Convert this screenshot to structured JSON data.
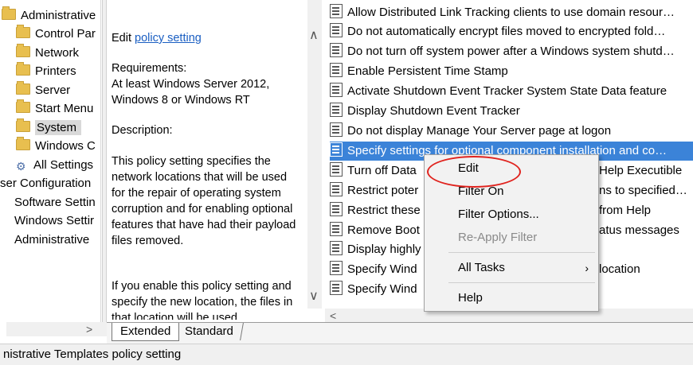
{
  "tree": {
    "items": [
      {
        "label": "Administrative",
        "icon": "folder-icon"
      },
      {
        "label": "Control Par",
        "icon": "folder-icon"
      },
      {
        "label": "Network",
        "icon": "folder-icon"
      },
      {
        "label": "Printers",
        "icon": "folder-icon"
      },
      {
        "label": "Server",
        "icon": "folder-icon"
      },
      {
        "label": "Start Menu",
        "icon": "folder-icon"
      },
      {
        "label": "System",
        "icon": "folder-icon",
        "selected": true
      },
      {
        "label": "Windows C",
        "icon": "folder-icon"
      },
      {
        "label": "All Settings",
        "icon": "settings-icon"
      },
      {
        "label": "ser Configuration",
        "icon": "none"
      },
      {
        "label": "Software Settin",
        "icon": "none"
      },
      {
        "label": "Windows Settir",
        "icon": "none"
      },
      {
        "label": "Administrative",
        "icon": "none"
      }
    ]
  },
  "description": {
    "edit_prefix": "Edit ",
    "edit_link": "policy setting ",
    "requirements_title": "Requirements:",
    "requirements_line1": "At least Windows Server 2012,",
    "requirements_line2": "Windows 8 or Windows RT",
    "description_title": "Description:",
    "para1": "This policy setting specifies the network locations that will be used for the repair of operating system corruption and for enabling optional features that have had their payload files removed.",
    "para2": "If you enable this policy setting and specify the new location, the files in that location will be used"
  },
  "policy_list": {
    "rows": [
      "Allow Distributed Link Tracking clients to use domain resour…",
      "Do not automatically encrypt files moved to encrypted fold…",
      "Do not turn off system power after a Windows system shutd…",
      "Enable Persistent Time Stamp",
      "Activate Shutdown Event Tracker System State Data feature",
      "Display Shutdown Event Tracker",
      "Do not display Manage Your Server page at logon",
      "Specify settings for optional component installation and co…",
      "Turn off Data",
      "Restrict poter",
      "Restrict these",
      "Remove Boot",
      "Display highly",
      "Specify Wind",
      "Specify Wind"
    ],
    "row_right_fragments": [
      "",
      "",
      "",
      "",
      "",
      "",
      "",
      "",
      "Help Executible",
      "ns to specified…",
      "from Help",
      "atus messages",
      "",
      "location",
      ""
    ],
    "selected_index": 7
  },
  "context_menu": {
    "edit": "Edit",
    "filter_on": "Filter On",
    "filter_options": "Filter Options...",
    "reapply_filter": "Re-Apply Filter",
    "all_tasks": "All Tasks",
    "help": "Help",
    "highlight_color": "#e0231e"
  },
  "tabs": {
    "extended": "Extended",
    "standard": "Standard"
  },
  "status_bar": {
    "text": "nistrative Templates policy setting"
  },
  "colors": {
    "selection": "#3b83d8",
    "link": "#1a5ec2"
  }
}
